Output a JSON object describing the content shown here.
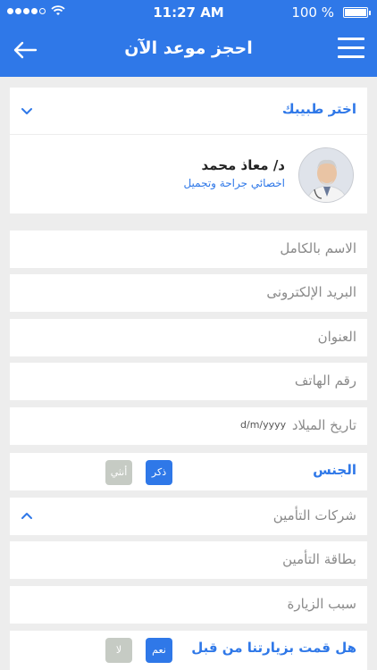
{
  "status": {
    "time": "11:27 AM",
    "battery": "100 %"
  },
  "nav": {
    "title": "احجز موعد الآن"
  },
  "doctor_select": {
    "label": "اختر طبيبك"
  },
  "doctor": {
    "name": "د/ معاذ محمد",
    "specialty": "اخصائي جراحة وتجميل"
  },
  "form": {
    "full_name": "الاسم بالكامل",
    "email": "البريد الإلكترونى",
    "address": "العنوان",
    "phone": "رقم الهاتف",
    "birth_date": "تاريخ الميلاد",
    "birth_date_format": "d/m/yyyy",
    "insurance_card": "بطاقة التأمين",
    "visit_reason": "سبب الزيارة"
  },
  "gender": {
    "label": "الجنس",
    "male": "ذكر",
    "female": "أنثي",
    "selected": "male"
  },
  "insurance": {
    "label": "شركات التأمين"
  },
  "visited": {
    "label": "هل قمت بزيارتنا من قبل",
    "yes": "نعم",
    "no": "لا",
    "selected": "yes"
  },
  "colors": {
    "primary": "#2f78e8",
    "background": "#ededed",
    "inactive_pill": "#c6cbc4"
  },
  "icons": {
    "back": "arrow-left-icon",
    "menu": "hamburger-menu-icon",
    "dropdown_closed": "chevron-down-icon",
    "dropdown_open": "chevron-up-icon"
  }
}
